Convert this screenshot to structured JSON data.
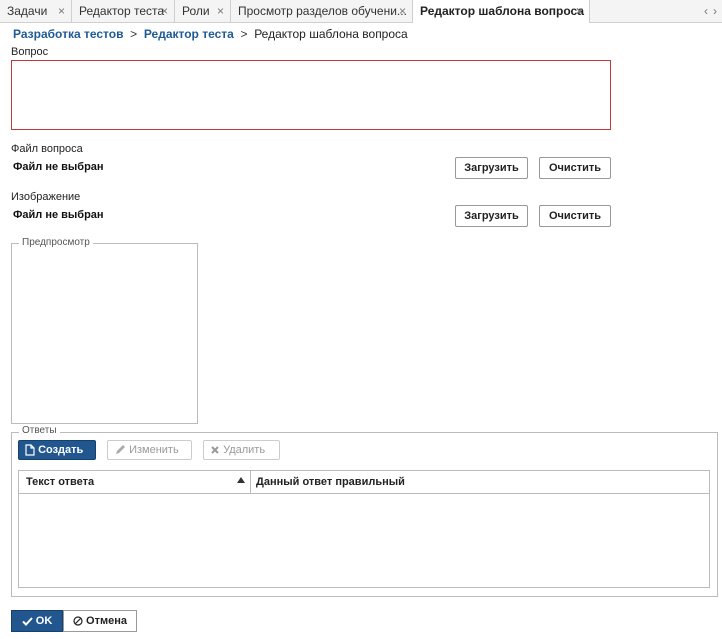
{
  "tabs": [
    {
      "label": "Задачи",
      "close": "×"
    },
    {
      "label": "Редактор теста",
      "close": "×"
    },
    {
      "label": "Роли",
      "close": "×"
    },
    {
      "label": "Просмотр разделов обучени...",
      "close": "×"
    },
    {
      "label": "Редактор шаблона вопроса",
      "close": "×"
    }
  ],
  "tab_scroll": {
    "left": "‹",
    "right": "›"
  },
  "breadcrumb": {
    "item1": "Разработка тестов",
    "sep": ">",
    "item2": "Редактор теста",
    "current": "Редактор шаблона вопроса"
  },
  "question": {
    "label": "Вопрос",
    "value": ""
  },
  "question_file": {
    "label": "Файл вопроса",
    "status": "Файл не выбран",
    "upload": "Загрузить",
    "clear": "Очистить"
  },
  "image": {
    "label": "Изображение",
    "status": "Файл не выбран",
    "upload": "Загрузить",
    "clear": "Очистить"
  },
  "preview": {
    "legend": "Предпросмотр"
  },
  "answers": {
    "legend": "Ответы",
    "create": "Создать",
    "edit": "Изменить",
    "delete": "Удалить",
    "columns": [
      "Текст ответа",
      "Данный ответ правильный"
    ],
    "rows": []
  },
  "footer": {
    "ok": "OK",
    "cancel": "Отмена"
  },
  "colors": {
    "accent": "#22568e",
    "link": "#1f5a96",
    "error_border": "#c0393b"
  }
}
